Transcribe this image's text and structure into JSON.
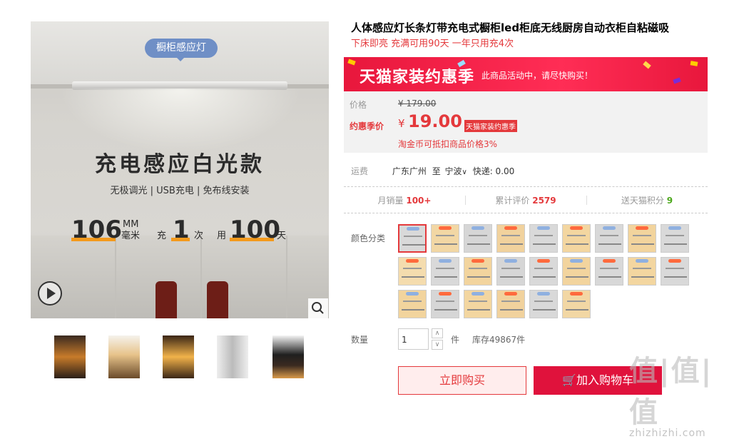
{
  "main_image": {
    "badge": "橱柜感应灯",
    "headline": "充电感应白光款",
    "features": "无极调光 | USB充电 | 免布线安装",
    "spec1_num": "106",
    "spec1_unit_top": "MM",
    "spec1_unit_bot": "毫米",
    "spec2_pre": "充",
    "spec2_num": "1",
    "spec2_unit": "次",
    "spec3_pre": "用",
    "spec3_num": "100",
    "spec3_unit": "天"
  },
  "product": {
    "title": "人体感应灯长条灯带充电式橱柜led柜底无线厨房自动衣柜自粘磁吸",
    "subtitle": "下床即亮 充满可用90天 一年只用充4次"
  },
  "promo": {
    "banner_title": "天猫家装约惠季",
    "banner_sub": "此商品活动中，请尽快购买！",
    "price_label": "价格",
    "orig_price": "¥ 179.00",
    "sale_label": "约惠季价",
    "currency": "¥",
    "sale_price": "19.00",
    "sale_tag": "天猫家装约惠季",
    "coin_note": "淘金币可抵扣商品价格3%"
  },
  "shipping": {
    "label": "运费",
    "from": "广东广州",
    "to_word": "至",
    "to": "宁波",
    "method": "快递: 0.00"
  },
  "stats": {
    "sales_label": "月销量",
    "sales": "100+",
    "reviews_label": "累计评价",
    "reviews": "2579",
    "points_label": "送天猫积分",
    "points": "9"
  },
  "color_label": "颜色分类",
  "quantity": {
    "label": "数量",
    "value": "1",
    "unit": "件",
    "stock": "库存49867件"
  },
  "buttons": {
    "buy": "立即购买",
    "cart": "加入购物车"
  },
  "watermark": {
    "main": "值|值|值",
    "sub": "zhizhizhi.com"
  },
  "colors": {
    "accent": "#e4393c",
    "banner": "#ff2d55",
    "cart": "#e0123c",
    "green": "#4ca81c"
  }
}
